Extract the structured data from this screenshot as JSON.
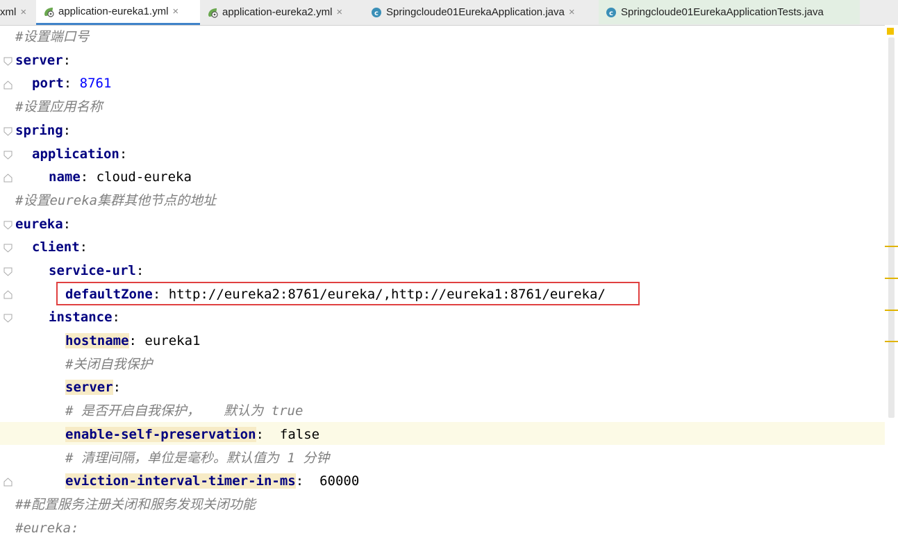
{
  "tabs": [
    {
      "name": "xml",
      "icon": "none",
      "state": "normal"
    },
    {
      "name": "application-eureka1.yml",
      "icon": "yaml-leaf-icon",
      "state": "active"
    },
    {
      "name": "application-eureka2.yml",
      "icon": "yaml-leaf-icon",
      "state": "normal"
    },
    {
      "name": "Springcloude01EurekaApplication.java",
      "icon": "java-class-icon",
      "state": "normal"
    },
    {
      "name": "Springcloude01EurekaApplicationTests.java",
      "icon": "java-class-icon",
      "state": "alt"
    }
  ],
  "close_glyph": "×",
  "colors": {
    "key": "#000080",
    "number": "#0000ff",
    "comment": "#808080",
    "highlight_box": "#e04040",
    "caret_line": "#fcfae6",
    "active_tab_underline": "#4083c9"
  },
  "editor": {
    "lines": [
      {
        "comment": "#设置端口号"
      },
      {
        "key": "server",
        "sep": ":"
      },
      {
        "key": "port",
        "sep": ": ",
        "number": "8761"
      },
      {
        "comment": "#设置应用名称"
      },
      {
        "key": "spring",
        "sep": ":"
      },
      {
        "key": "application",
        "sep": ":"
      },
      {
        "key": "name",
        "sep": ": ",
        "value": "cloud-eureka"
      },
      {
        "comment": "#设置eureka集群其他节点的地址"
      },
      {
        "key": "eureka",
        "sep": ":"
      },
      {
        "key": "client",
        "sep": ":"
      },
      {
        "key": "service-url",
        "sep": ":"
      },
      {
        "key": "defaultZone",
        "sep": ": ",
        "value": "http://eureka2:8761/eureka/,http://eureka1:8761/eureka/"
      },
      {
        "key": "instance",
        "sep": ":"
      },
      {
        "key": "hostname",
        "sep": ": ",
        "value": "eureka1"
      },
      {
        "comment": "#关闭自我保护"
      },
      {
        "key": "server",
        "sep": ":"
      },
      {
        "comment": "# 是否开启自我保护，   默认为 true"
      },
      {
        "key": "enable-self-preservation",
        "sep": ":  ",
        "value": "false"
      },
      {
        "comment": "# 清理间隔，单位是毫秒。默认值为 1 分钟"
      },
      {
        "key": "eviction-interval-timer-in-ms",
        "sep": ":  ",
        "value": "60000"
      },
      {
        "comment": "##配置服务注册关闭和服务发现关闭功能"
      },
      {
        "comment": "#eureka:"
      }
    ]
  }
}
